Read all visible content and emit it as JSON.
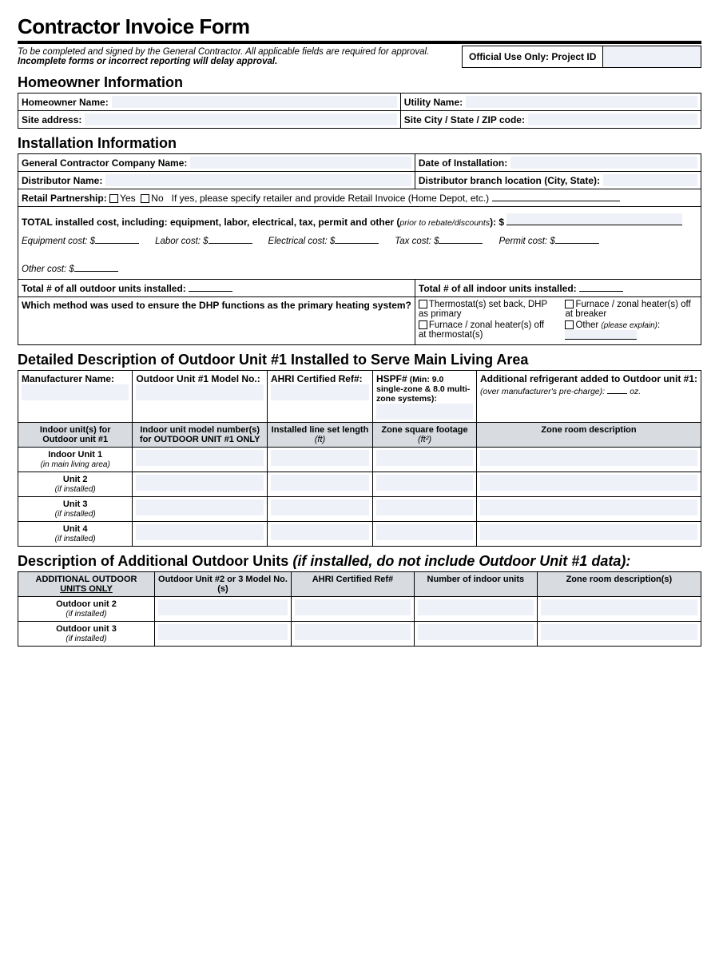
{
  "title": "Contractor Invoice Form",
  "note_line1": "To be completed and signed by the General Contractor.  All applicable fields are required for approval.",
  "note_line2": "Incomplete forms or incorrect reporting will delay approval.",
  "official_use": "Official Use Only: Project ID",
  "homeowner": {
    "heading": "Homeowner Information",
    "name": "Homeowner Name:",
    "utility": "Utility Name:",
    "address": "Site address:",
    "city": "Site City / State / ZIP code:"
  },
  "install": {
    "heading": "Installation Information",
    "gc": "General Contractor Company Name",
    "date": "Date of Installation:",
    "dist": "Distributor Name:",
    "branch": "Distributor branch location (City, State):",
    "retail_label": "Retail Partnership:",
    "retail_yes": "Yes",
    "retail_no": "No",
    "retail_note": "If yes, please specify retailer and provide Retail Invoice (Home Depot, etc.)",
    "total_cost_label": "TOTAL installed cost, including: equipment, labor, electrical, tax, permit and other (",
    "total_cost_paren": "prior to rebate/discounts",
    "total_cost_close": "): $",
    "equip": "Equipment cost: $",
    "labor": "Labor cost: $",
    "elec": "Electrical cost: $",
    "tax": "Tax cost: $",
    "permit": "Permit cost: $",
    "other": "Other cost: $",
    "outdoor_count": "Total # of all outdoor units installed",
    "indoor_count": "Total # of all indoor units installed:",
    "method_q": "Which method was used to ensure the DHP functions as the primary heating system?",
    "m1": "Thermostat(s) set back, DHP as primary",
    "m2": "Furnace / zonal heater(s) off at breaker",
    "m3": "Furnace / zonal heater(s) off at thermostat(s)",
    "m4": "Other",
    "m4_paren": "(please explain)"
  },
  "unit1": {
    "heading": "Detailed Description of Outdoor Unit #1 Installed to Serve Main Living Area",
    "h1": "Manufacturer Name:",
    "h2": "Outdoor Unit #1 Model No.:",
    "h3": "AHRI Certified Ref#:",
    "h4": "HSPF#",
    "h4_note": "(Min: 9.0 single-zone & 8.0 multi-zone systems):",
    "h5": "Additional refrigerant added to Outdoor unit #1:",
    "h5_note": "(over manufacturer's pre-charge):",
    "h5_unit": "oz.",
    "col1": "Indoor unit(s) for Outdoor unit #1",
    "col2": "Indoor unit model number(s) for OUTDOOR UNIT #1 ONLY",
    "col3": "Installed line set length",
    "col3_sub": "(ft)",
    "col4": "Zone square footage",
    "col4_sub": "(ft²)",
    "col5": "Zone room description",
    "r1": "Indoor Unit 1",
    "r1_sub": "(in main living area)",
    "r2": "Unit 2",
    "r3": "Unit 3",
    "r4": "Unit 4",
    "r_sub": "(if installed)"
  },
  "addl": {
    "heading": "Description of Additional Outdoor Units",
    "heading_suffix": "(if installed, do not include Outdoor Unit #1 data):",
    "c1a": "ADDITIONAL OUTDOOR",
    "c1b": "UNITS ONLY",
    "c2": "Outdoor Unit #2 or 3 Model No.(s)",
    "c3": "AHRI Certified Ref#",
    "c4": "Number of indoor units",
    "c5": "Zone room description(s)",
    "r1": "Outdoor unit 2",
    "r2": "Outdoor unit 3",
    "r_sub": "(if installed)"
  }
}
